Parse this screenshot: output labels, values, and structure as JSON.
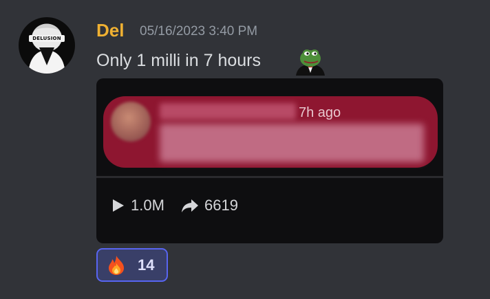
{
  "message": {
    "avatar": {
      "icon": "masked-figure-avatar",
      "badge_text": "DELUSION"
    },
    "author": "Del",
    "author_color": "#f0b132",
    "timestamp": "05/16/2023 3:40 PM",
    "text": "Only 1 milli in 7 hours",
    "inline_emoji": "pepe-tuxedo-emoji"
  },
  "embed": {
    "notification": {
      "time": "7h ago",
      "background": "#8e1630"
    },
    "stats": {
      "views": "1.0M",
      "views_icon": "play-icon",
      "shares": "6619",
      "shares_icon": "share-arrow-icon"
    }
  },
  "reaction": {
    "emoji": "fire-emoji",
    "count": "14",
    "accent": "#5865f2"
  }
}
